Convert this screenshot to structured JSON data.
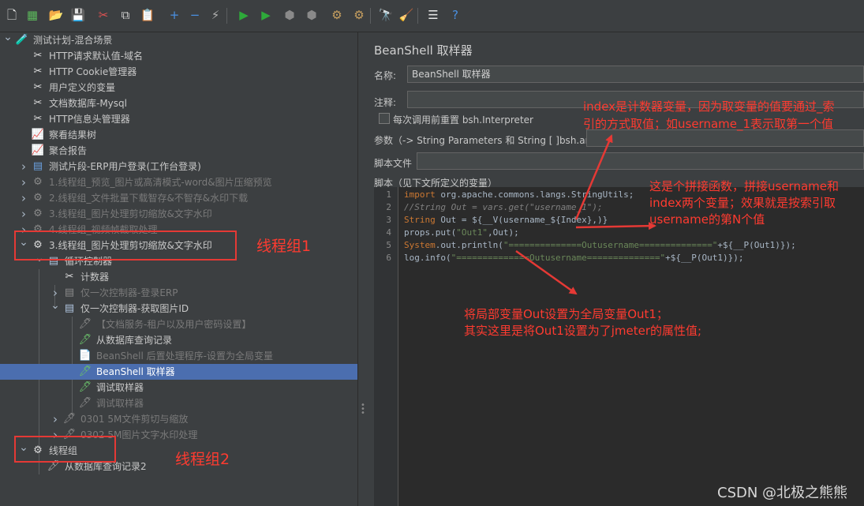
{
  "toolbar": {
    "buttons": [
      {
        "name": "new-icon",
        "glyph": "🗋",
        "color": "#e8e8e8"
      },
      {
        "name": "templates-icon",
        "glyph": "▦",
        "color": "#5cb85c"
      },
      {
        "name": "open-icon",
        "glyph": "📂",
        "color": "#e6b422"
      },
      {
        "name": "save-icon",
        "glyph": "💾",
        "color": "#9fb3c8"
      },
      {
        "name": "cut-icon",
        "glyph": "✂",
        "color": "#e05252"
      },
      {
        "name": "copy-icon",
        "glyph": "⧉",
        "color": "#d0d0d0"
      },
      {
        "name": "paste-icon",
        "glyph": "📋",
        "color": "#e6b422"
      },
      {
        "name": "expand-icon",
        "glyph": "+",
        "color": "#4a90e2"
      },
      {
        "name": "collapse-icon",
        "glyph": "−",
        "color": "#4a90e2"
      },
      {
        "name": "toggle-icon",
        "glyph": "⚡",
        "color": "#b0b0b0"
      },
      {
        "name": "start-icon",
        "glyph": "▶",
        "color": "#2eaa3a"
      },
      {
        "name": "start-no-pauses-icon",
        "glyph": "▶",
        "color": "#2eaa3a"
      },
      {
        "name": "stop-icon",
        "glyph": "⬢",
        "color": "#8a8a8a"
      },
      {
        "name": "shutdown-icon",
        "glyph": "⬢",
        "color": "#8a8a8a"
      },
      {
        "name": "clear-icon",
        "glyph": "⚙",
        "color": "#c8a060"
      },
      {
        "name": "clear-all-icon",
        "glyph": "⚙",
        "color": "#c8a060"
      },
      {
        "name": "search-icon",
        "glyph": "🔭",
        "color": "#d0d0d0"
      },
      {
        "name": "reset-search-icon",
        "glyph": "🧹",
        "color": "#e6c422"
      },
      {
        "name": "function-helper-icon",
        "glyph": "☰",
        "color": "#e8e8e8"
      },
      {
        "name": "help-icon",
        "glyph": "?",
        "color": "#4a90e2"
      }
    ]
  },
  "tree": {
    "rows": [
      {
        "name": "tree-test-plan",
        "text": "测试计划-混合场景",
        "indent": 0,
        "arrow": "down",
        "icon": "🧪",
        "icolor": "#9fb3c8",
        "disabled": false,
        "selected": false
      },
      {
        "name": "tree-http-defaults",
        "text": "HTTP请求默认值-域名",
        "indent": 1,
        "arrow": "",
        "icon": "✂",
        "icolor": "#e0e0e0",
        "disabled": false,
        "selected": false
      },
      {
        "name": "tree-cookie-manager",
        "text": "HTTP Cookie管理器",
        "indent": 1,
        "arrow": "",
        "icon": "✂",
        "icolor": "#e0e0e0",
        "disabled": false,
        "selected": false
      },
      {
        "name": "tree-user-vars",
        "text": "用户定义的变量",
        "indent": 1,
        "arrow": "",
        "icon": "✂",
        "icolor": "#e0e0e0",
        "disabled": false,
        "selected": false
      },
      {
        "name": "tree-mysql",
        "text": "文档数据库-Mysql",
        "indent": 1,
        "arrow": "",
        "icon": "✂",
        "icolor": "#e0e0e0",
        "disabled": false,
        "selected": false
      },
      {
        "name": "tree-header-manager",
        "text": "HTTP信息头管理器",
        "indent": 1,
        "arrow": "",
        "icon": "✂",
        "icolor": "#e0e0e0",
        "disabled": false,
        "selected": false
      },
      {
        "name": "tree-view-results",
        "text": "察看结果树",
        "indent": 1,
        "arrow": "",
        "icon": "📈",
        "icolor": "#c0a0e0",
        "disabled": false,
        "selected": false
      },
      {
        "name": "tree-aggregate-report",
        "text": "聚合报告",
        "indent": 1,
        "arrow": "",
        "icon": "📈",
        "icolor": "#c0a0e0",
        "disabled": false,
        "selected": false
      },
      {
        "name": "tree-fragment-login",
        "text": "测试片段-ERP用户登录(工作台登录)",
        "indent": 1,
        "arrow": "right",
        "icon": "▤",
        "icolor": "#6aa0e0",
        "disabled": false,
        "selected": false
      },
      {
        "name": "tree-tg-1",
        "text": "1.线程组_预览_图片或高清模式-word&图片压缩预览",
        "indent": 1,
        "arrow": "right",
        "icon": "⚙",
        "icolor": "#8a8a8a",
        "disabled": true,
        "selected": false
      },
      {
        "name": "tree-tg-2",
        "text": "2.线程组_文件批量下载智存&不智存&水印下载",
        "indent": 1,
        "arrow": "right",
        "icon": "⚙",
        "icolor": "#8a8a8a",
        "disabled": true,
        "selected": false
      },
      {
        "name": "tree-tg-3a",
        "text": "3.线程组_图片处理剪切缩放&文字水印",
        "indent": 1,
        "arrow": "right",
        "icon": "⚙",
        "icolor": "#8a8a8a",
        "disabled": true,
        "selected": false
      },
      {
        "name": "tree-tg-4",
        "text": "4.线程组_视频帧截取处理",
        "indent": 1,
        "arrow": "right",
        "icon": "⚙",
        "icolor": "#8a8a8a",
        "disabled": true,
        "selected": false
      },
      {
        "name": "tree-tg-3b",
        "text": "3.线程组_图片处理剪切缩放&文字水印",
        "indent": 1,
        "arrow": "down",
        "icon": "⚙",
        "icolor": "#dcdcdc",
        "disabled": false,
        "selected": false
      },
      {
        "name": "tree-loop-controller",
        "text": "循环控制器",
        "indent": 2,
        "arrow": "down",
        "icon": "▤",
        "icolor": "#b0c4de",
        "disabled": false,
        "selected": false
      },
      {
        "name": "tree-counter",
        "text": "计数器",
        "indent": 3,
        "arrow": "",
        "icon": "✂",
        "icolor": "#e0e0e0",
        "disabled": false,
        "selected": false
      },
      {
        "name": "tree-once-login",
        "text": "仅一次控制器-登录ERP",
        "indent": 3,
        "arrow": "right",
        "icon": "▤",
        "icolor": "#8a8a8a",
        "disabled": true,
        "selected": false
      },
      {
        "name": "tree-once-get-id",
        "text": "仅一次控制器-获取图片ID",
        "indent": 3,
        "arrow": "down",
        "icon": "▤",
        "icolor": "#b0c4de",
        "disabled": false,
        "selected": false
      },
      {
        "name": "tree-doc-service",
        "text": "【文档服务-租户以及用户密码设置】",
        "indent": 4,
        "arrow": "",
        "icon": "🖊",
        "icolor": "#8a8a8a",
        "disabled": true,
        "selected": false
      },
      {
        "name": "tree-db-query",
        "text": "从数据库查询记录",
        "indent": 4,
        "arrow": "",
        "icon": "🖊",
        "icolor": "#6abf6a",
        "disabled": false,
        "selected": false
      },
      {
        "name": "tree-beanshell-post",
        "text": "BeanShell 后置处理程序-设置为全局变量",
        "indent": 4,
        "arrow": "",
        "icon": "📄",
        "icolor": "#8a8a8a",
        "disabled": true,
        "selected": false
      },
      {
        "name": "tree-beanshell-sampler",
        "text": "BeanShell 取样器",
        "indent": 4,
        "arrow": "",
        "icon": "🖊",
        "icolor": "#6abf6a",
        "disabled": false,
        "selected": true
      },
      {
        "name": "tree-debug-sampler-1",
        "text": "调试取样器",
        "indent": 4,
        "arrow": "",
        "icon": "🖊",
        "icolor": "#6abf6a",
        "disabled": false,
        "selected": false
      },
      {
        "name": "tree-debug-sampler-2",
        "text": "调试取样器",
        "indent": 4,
        "arrow": "",
        "icon": "🖊",
        "icolor": "#8a8a8a",
        "disabled": true,
        "selected": false
      },
      {
        "name": "tree-crop-scale",
        "text": "0301 5M文件剪切与缩放",
        "indent": 3,
        "arrow": "right",
        "icon": "🖊",
        "icolor": "#8a8a8a",
        "disabled": true,
        "selected": false
      },
      {
        "name": "tree-watermark",
        "text": "0302 5M图片文字水印处理",
        "indent": 3,
        "arrow": "right",
        "icon": "🖊",
        "icolor": "#8a8a8a",
        "disabled": true,
        "selected": false
      },
      {
        "name": "tree-thread-group",
        "text": "线程组",
        "indent": 1,
        "arrow": "down",
        "icon": "⚙",
        "icolor": "#dcdcdc",
        "disabled": false,
        "selected": false
      },
      {
        "name": "tree-db-query-2",
        "text": "从数据库查询记录2",
        "indent": 2,
        "arrow": "",
        "icon": "🖊",
        "icolor": "#b0b0b0",
        "disabled": false,
        "selected": false
      }
    ]
  },
  "panel": {
    "title": "BeanShell 取样器",
    "name_label": "名称:",
    "name_value": "BeanShell 取样器",
    "comment_label": "注释:",
    "comment_value": "",
    "reset_label": "每次调用前重置 bsh.Interpreter",
    "params_label": "参数（-> String Parameters 和 String [ ]bsh.args）",
    "params_value": "",
    "file_label": "脚本文件",
    "file_value": "",
    "script_label": "脚本（见下文所定义的变量）"
  },
  "code": {
    "lines": [
      [
        {
          "t": "import",
          "c": "kw"
        },
        {
          "t": " org.apache.commons.langs.StringUtils;",
          "c": "tx"
        }
      ],
      [
        {
          "t": "//String Out = vars.get(\"username_1\");",
          "c": "cm"
        }
      ],
      [
        {
          "t": "String",
          "c": "kw"
        },
        {
          "t": " Out = ${__V(username_${Index},)}",
          "c": "tx"
        }
      ],
      [
        {
          "t": "props.put(",
          "c": "tx"
        },
        {
          "t": "\"Out1\"",
          "c": "str"
        },
        {
          "t": ",Out);",
          "c": "tx"
        }
      ],
      [
        {
          "t": "System",
          "c": "kw"
        },
        {
          "t": ".out.println(",
          "c": "tx"
        },
        {
          "t": "\"==============Outusername==============\"",
          "c": "str"
        },
        {
          "t": "+${__P(Out1)});",
          "c": "tx"
        }
      ],
      [
        {
          "t": "log.info(",
          "c": "tx"
        },
        {
          "t": "\"==============Outusername==============\"",
          "c": "str"
        },
        {
          "t": "+${__P(Out1)});",
          "c": "tx"
        }
      ]
    ]
  },
  "annotations": {
    "label_tg1": "线程组1",
    "label_tg2": "线程组2",
    "note_index_1": "index是计数器变量，因为取变量的值要通过_索",
    "note_index_2": "引的方式取值；如username_1表示取第一个值",
    "note_concat_1": "这是个拼接函数，拼接username和",
    "note_concat_2": "index两个变量；效果就是按索引取",
    "note_concat_3": "username的第N个值",
    "note_global_1": "将局部变量Out设置为全局变量Out1；",
    "note_global_2": "其实这里是将Out1设置为了jmeter的属性值;",
    "watermark": "CSDN @北极之熊熊"
  }
}
